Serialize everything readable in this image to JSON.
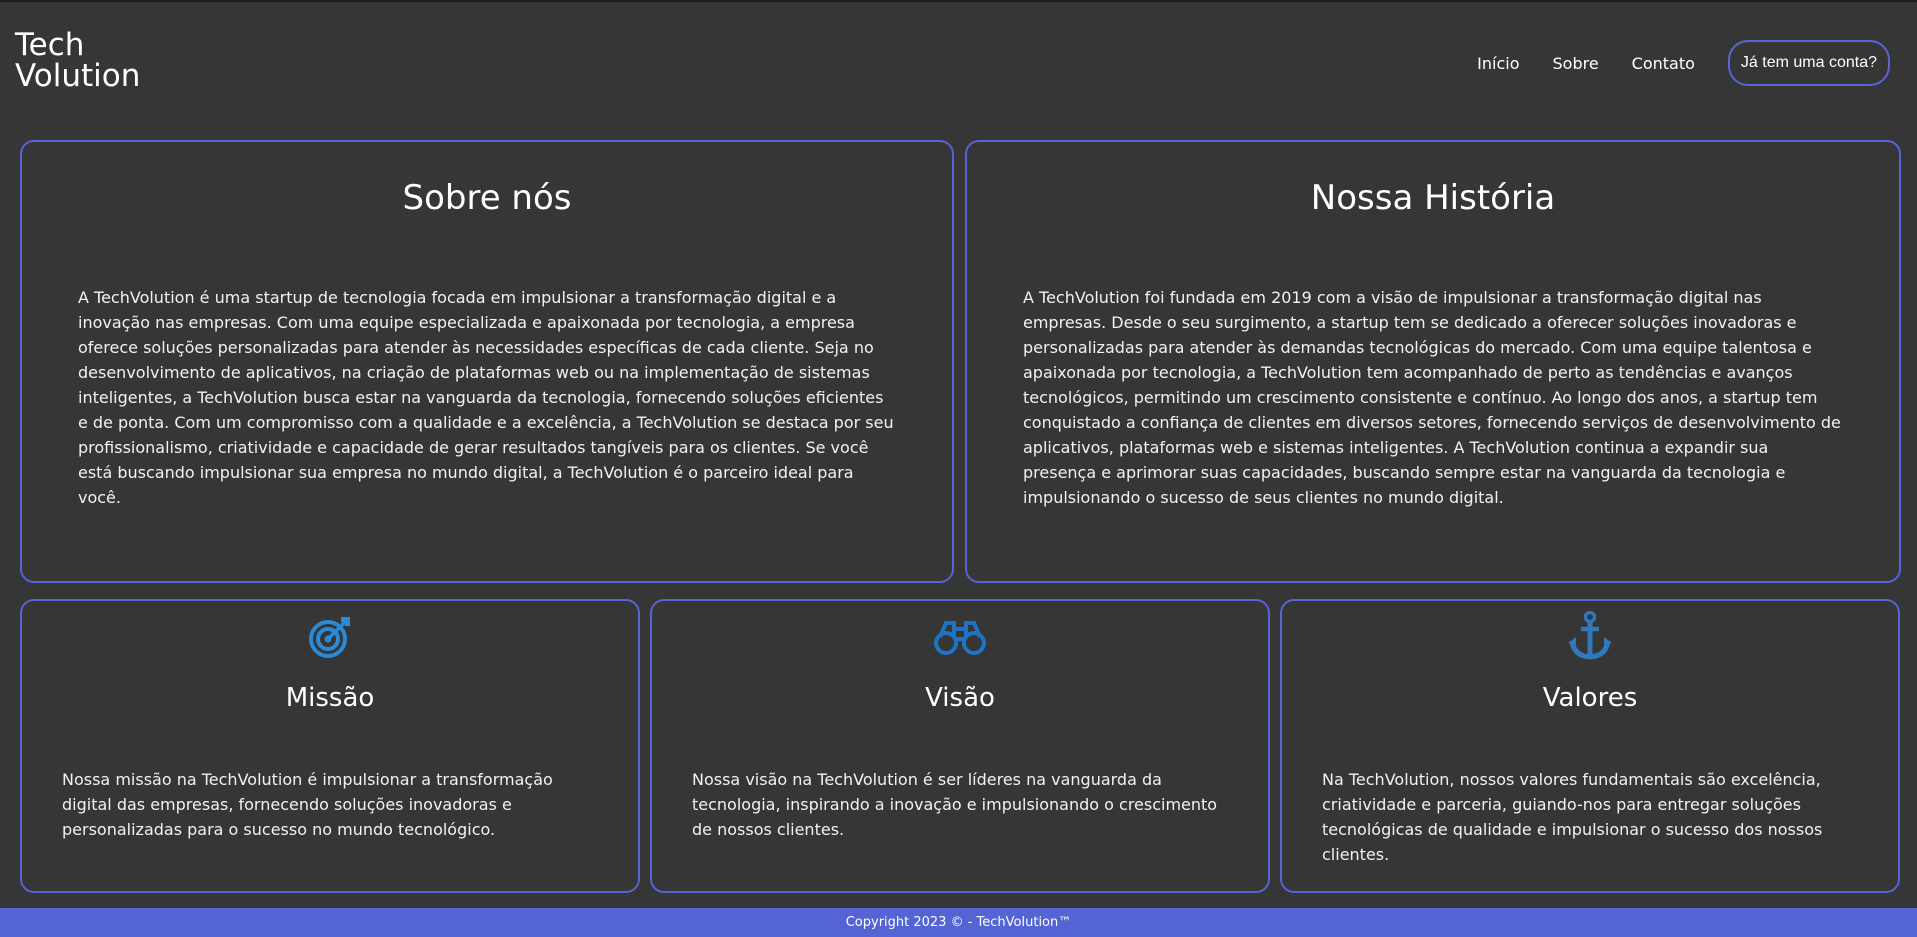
{
  "header": {
    "logo_line1": "Tech",
    "logo_line2": "Volution",
    "nav": [
      "Início",
      "Sobre",
      "Contato"
    ],
    "login_label": "Já tem uma conta?"
  },
  "about": {
    "title": "Sobre nós",
    "text": "A TechVolution é uma startup de tecnologia focada em impulsionar a transformação digital e a inovação nas empresas. Com uma equipe especializada e apaixonada por tecnologia, a empresa oferece soluções personalizadas para atender às necessidades específicas de cada cliente. Seja no desenvolvimento de aplicativos, na criação de plataformas web ou na implementação de sistemas inteligentes, a TechVolution busca estar na vanguarda da tecnologia, fornecendo soluções eficientes e de ponta. Com um compromisso com a qualidade e a excelência, a TechVolution se destaca por seu profissionalismo, criatividade e capacidade de gerar resultados tangíveis para os clientes. Se você está buscando impulsionar sua empresa no mundo digital, a TechVolution é o parceiro ideal para você."
  },
  "history": {
    "title": "Nossa História",
    "text": "A TechVolution foi fundada em 2019 com a visão de impulsionar a transformação digital nas empresas. Desde o seu surgimento, a startup tem se dedicado a oferecer soluções inovadoras e personalizadas para atender às demandas tecnológicas do mercado. Com uma equipe talentosa e apaixonada por tecnologia, a TechVolution tem acompanhado de perto as tendências e avanços tecnológicos, permitindo um crescimento consistente e contínuo. Ao longo dos anos, a startup tem conquistado a confiança de clientes em diversos setores, fornecendo serviços de desenvolvimento de aplicativos, plataformas web e sistemas inteligentes. A TechVolution continua a expandir sua presença e aprimorar suas capacidades, buscando sempre estar na vanguarda da tecnologia e impulsionando o sucesso de seus clientes no mundo digital."
  },
  "mission": {
    "icon": "target-icon",
    "title": "Missão",
    "text": "Nossa missão na TechVolution é impulsionar a transformação digital das empresas, fornecendo soluções inovadoras e personalizadas para o sucesso no mundo tecnológico."
  },
  "vision": {
    "icon": "binoculars-icon",
    "title": "Visão",
    "text": "Nossa visão na TechVolution é ser líderes na vanguarda da tecnologia, inspirando a inovação e impulsionando o crescimento de nossos clientes."
  },
  "values": {
    "icon": "anchor-icon",
    "title": "Valores",
    "text": "Na TechVolution, nossos valores fundamentais são excelência, criatividade e parceria, guiando-nos para entregar soluções tecnológicas de qualidade e impulsionar o sucesso dos nossos clientes."
  },
  "footer": {
    "copyright": "Copyright 2023 © - TechVolution™"
  },
  "colors": {
    "background": "#363636",
    "accent": "#5563d6",
    "icon_blue": "#2a8ad6",
    "footer": "#5464d4"
  }
}
